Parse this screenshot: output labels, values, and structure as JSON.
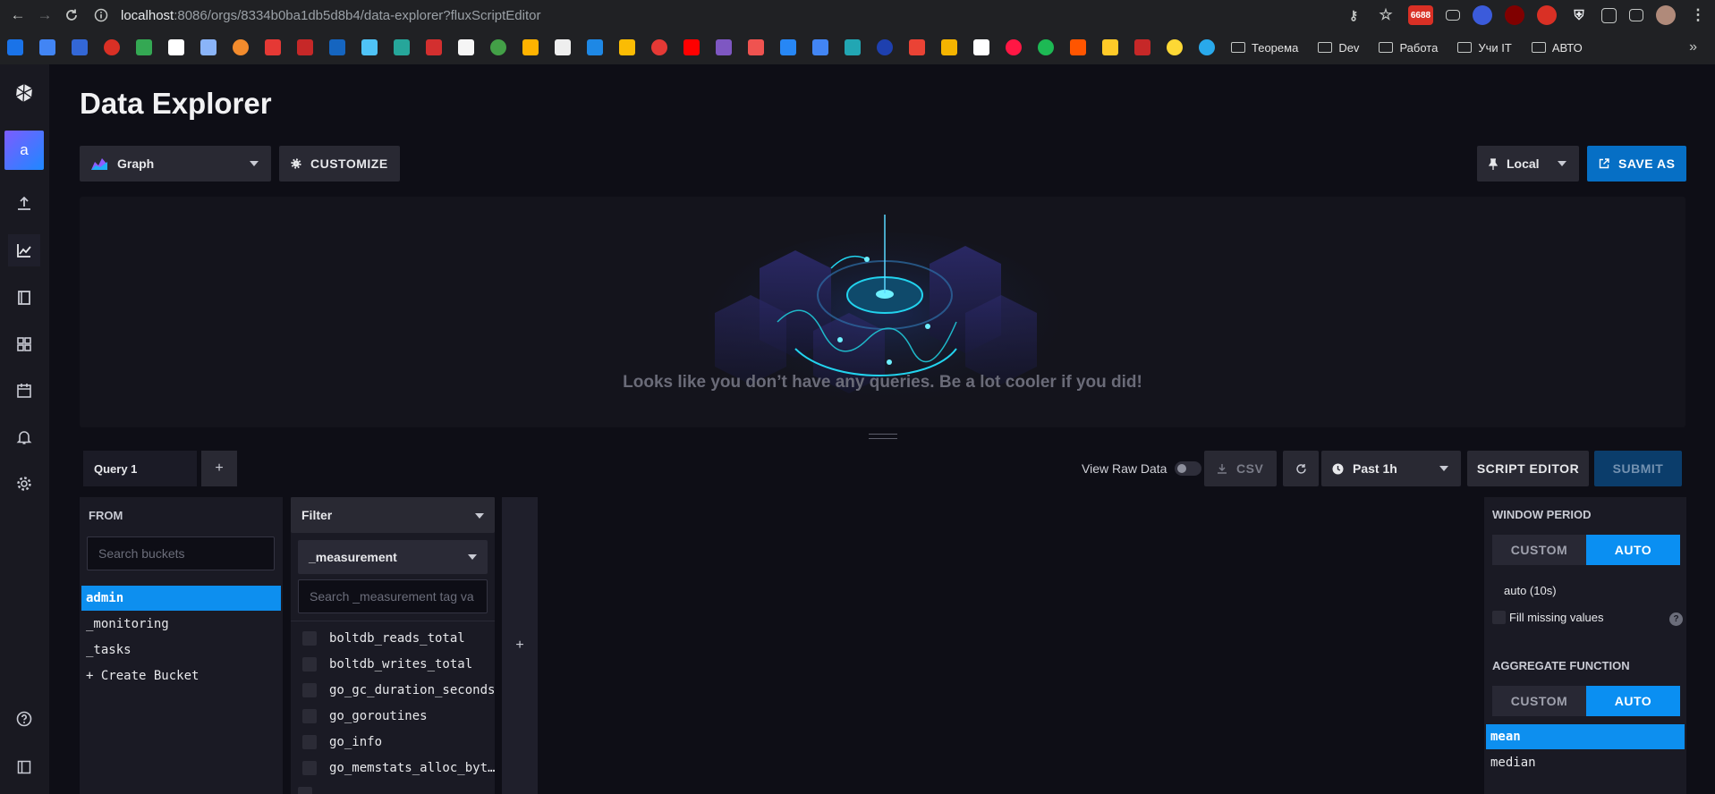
{
  "browser": {
    "url_host": "localhost",
    "url_path": ":8086/orgs/8334b0ba1db5d8b4/data-explorer?fluxScriptEditor",
    "ext_badge": "6688",
    "bookmark_folders": [
      "Теорема",
      "Dev",
      "Работа",
      "Учи IT",
      "АВТО"
    ]
  },
  "header": {
    "title": "Data Explorer",
    "viz_type": "Graph",
    "customize": "CUSTOMIZE",
    "pin_mode": "Local",
    "save_as": "SAVE AS"
  },
  "graph": {
    "empty_message": "Looks like you don’t have any queries. Be a lot cooler if you did!"
  },
  "query_bar": {
    "tab": "Query 1",
    "add": "+",
    "view_raw": "View Raw Data",
    "csv": "CSV",
    "time_range": "Past 1h",
    "script_editor": "SCRIPT EDITOR",
    "submit": "SUBMIT"
  },
  "from_panel": {
    "title": "FROM",
    "search_placeholder": "Search buckets",
    "buckets": [
      "admin",
      "_monitoring",
      "_tasks",
      "+ Create Bucket"
    ],
    "selected": "admin"
  },
  "filter_panel": {
    "title": "Filter",
    "key": "_measurement",
    "search_placeholder": "Search _measurement tag va",
    "values": [
      "boltdb_reads_total",
      "boltdb_writes_total",
      "go_gc_duration_seconds",
      "go_goroutines",
      "go_info",
      "go_memstats_alloc_byt…"
    ],
    "add": "+"
  },
  "window_panel": {
    "title": "WINDOW PERIOD",
    "custom": "CUSTOM",
    "auto": "AUTO",
    "period": "auto (10s)",
    "fill_missing": "Fill missing values",
    "help": "?",
    "agg_title": "AGGREGATE FUNCTION",
    "functions": [
      "mean",
      "median"
    ],
    "selected": "mean"
  },
  "colors": {
    "accent": "#0a8ff2",
    "save_blue": "#066fc5",
    "background": "#0e0e16"
  }
}
